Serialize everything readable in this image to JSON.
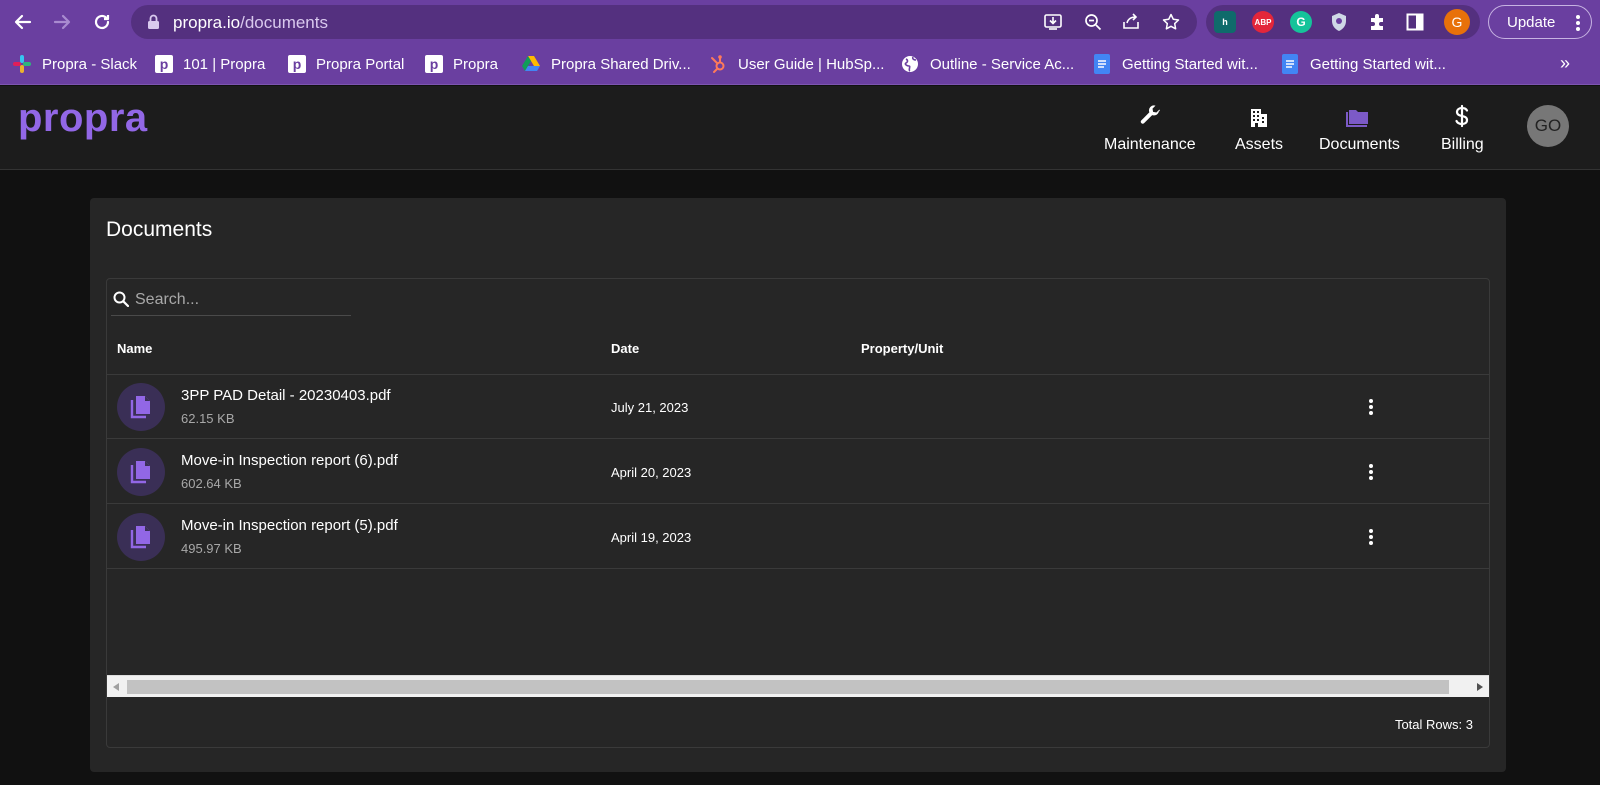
{
  "browser": {
    "url_host": "propra.io",
    "url_path": "/documents",
    "update_label": "Update",
    "profile_initial": "G",
    "extensions": [
      {
        "name": "h-ext-icon",
        "label": "h",
        "color": "#0f6b6b"
      },
      {
        "name": "adblock-plus-icon",
        "label": "ABP",
        "color": "#e3263a"
      },
      {
        "name": "grammarly-icon",
        "label": "G",
        "color": "#15c39a"
      },
      {
        "name": "shield-ext-icon",
        "label": "",
        "color": "#cfd8e6"
      }
    ]
  },
  "bookmarks": [
    {
      "label": "Propra - Slack",
      "icon": "slack-icon"
    },
    {
      "label": "101 | Propra",
      "icon": "propra-icon"
    },
    {
      "label": "Propra Portal",
      "icon": "propra-icon"
    },
    {
      "label": "Propra",
      "icon": "propra-icon"
    },
    {
      "label": "Propra Shared Driv...",
      "icon": "google-drive-icon"
    },
    {
      "label": "User Guide | HubSp...",
      "icon": "hubspot-icon"
    },
    {
      "label": "Outline - Service Ac...",
      "icon": "globe-icon"
    },
    {
      "label": "Getting Started wit...",
      "icon": "google-docs-icon"
    },
    {
      "label": "Getting Started wit...",
      "icon": "google-docs-icon"
    }
  ],
  "bookmarks_more": "»",
  "app": {
    "logo": "propra",
    "nav": [
      {
        "label": "Maintenance",
        "icon": "wrench-icon"
      },
      {
        "label": "Assets",
        "icon": "building-icon"
      },
      {
        "label": "Documents",
        "icon": "folder-icon",
        "active": true
      },
      {
        "label": "Billing",
        "icon": "dollar-icon"
      }
    ],
    "avatar": "GO"
  },
  "documents": {
    "title": "Documents",
    "search_placeholder": "Search...",
    "columns": [
      "Name",
      "Date",
      "Property/Unit"
    ],
    "rows": [
      {
        "name": "3PP PAD Detail - 20230403.pdf",
        "size": "62.15 KB",
        "date": "July 21, 2023",
        "property": ""
      },
      {
        "name": "Move-in Inspection report (6).pdf",
        "size": "602.64 KB",
        "date": "April 20, 2023",
        "property": ""
      },
      {
        "name": "Move-in Inspection report (5).pdf",
        "size": "495.97 KB",
        "date": "April 19, 2023",
        "property": ""
      }
    ],
    "total_rows": "Total Rows: 3"
  },
  "colors": {
    "chrome": "#6a3fa0",
    "accent": "#9267e6",
    "card": "#262626",
    "background": "#111111"
  }
}
